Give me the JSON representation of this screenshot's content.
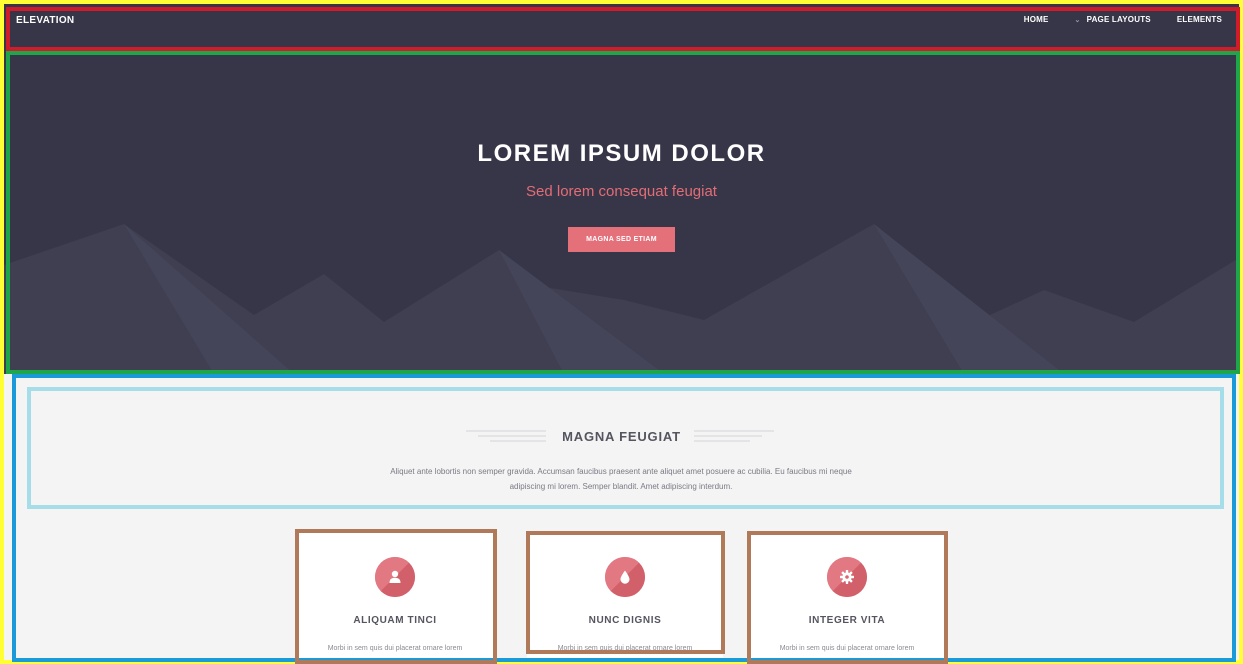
{
  "nav": {
    "brand": "ELEVATION",
    "links": [
      {
        "label": "HOME"
      },
      {
        "label": "PAGE LAYOUTS",
        "has_dropdown": true
      },
      {
        "label": "ELEMENTS"
      }
    ]
  },
  "hero": {
    "title": "LOREM IPSUM DOLOR",
    "subtitle": "Sed lorem consequat feugiat",
    "button": "MAGNA SED ETIAM"
  },
  "section": {
    "heading": "MAGNA FEUGIAT",
    "text": "Aliquet ante lobortis non semper gravida. Accumsan faucibus praesent ante aliquet amet posuere ac cubilia. Eu faucibus mi neque adipiscing mi lorem. Semper blandit. Amet adipiscing interdum."
  },
  "cards": [
    {
      "icon": "user-icon",
      "title": "ALIQUAM TINCI",
      "text": "Morbi in sem quis dui placerat ornare lorem"
    },
    {
      "icon": "drop-icon",
      "title": "NUNC DIGNIS",
      "text": "Morbi in sem quis dui placerat ornare lorem"
    },
    {
      "icon": "gear-icon",
      "title": "INTEGER VITA",
      "text": "Morbi in sem quis dui placerat ornare lorem"
    }
  ],
  "colors": {
    "nav_bg": "#363648",
    "accent": "#e4707a",
    "section_bg": "#f4f4f4",
    "card_bg": "#ffffff",
    "frame_yellow": "#ffff33",
    "frame_red": "#d01c2a",
    "frame_green": "#1fa54a",
    "frame_blue": "#1a9ad8",
    "frame_lightblue": "#a5dde8",
    "frame_brown": "#b07a5a"
  }
}
